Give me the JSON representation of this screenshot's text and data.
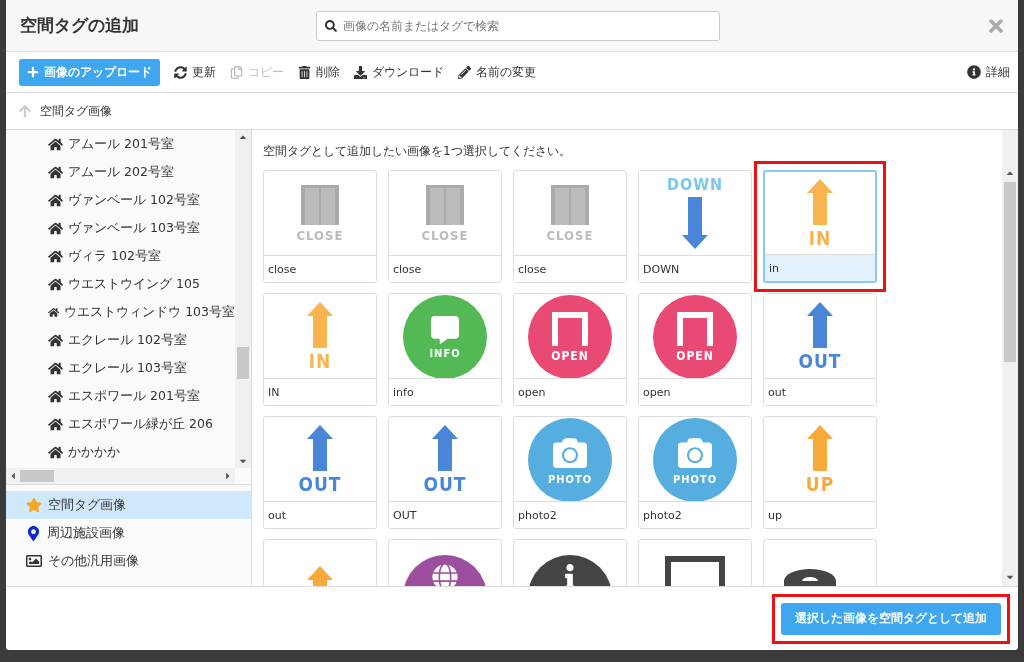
{
  "dialog": {
    "title": "空間タグの追加",
    "search": {
      "placeholder": "画像の名前またはタグで検索"
    }
  },
  "toolbar": {
    "upload": "画像のアップロード",
    "actions": [
      {
        "label": "更新",
        "disabled": false
      },
      {
        "label": "コピー",
        "disabled": true
      },
      {
        "label": "削除",
        "disabled": false
      },
      {
        "label": "ダウンロード",
        "disabled": false
      },
      {
        "label": "名前の変更",
        "disabled": false
      }
    ],
    "details": "詳細"
  },
  "breadcrumb": "空間タグ画像",
  "tree": [
    "アムール 201号室",
    "アムール 202号室",
    "ヴァンベール 102号室",
    "ヴァンベール 103号室",
    "ヴィラ 102号室",
    "ウエストウイング 105",
    "ウエストウィンドウ 103号室",
    "エクレール 102号室",
    "エクレール 103号室",
    "エスポワール 201号室",
    "エスポワール緑が丘 206",
    "かかかか"
  ],
  "categories": [
    {
      "label": "空間タグ画像",
      "selected": true
    },
    {
      "label": "周辺施設画像",
      "selected": false
    },
    {
      "label": "その他汎用画像",
      "selected": false
    }
  ],
  "instruction": "空間タグとして追加したい画像を1つ選択してください。",
  "tiles": [
    {
      "kind": "door",
      "text": "CLOSE",
      "label": "close",
      "selected": false,
      "highlighted": false
    },
    {
      "kind": "door",
      "text": "CLOSE",
      "label": "close",
      "selected": false,
      "highlighted": false
    },
    {
      "kind": "door",
      "text": "CLOSE",
      "label": "close",
      "selected": false,
      "highlighted": false
    },
    {
      "kind": "arrow-down",
      "text": "DOWN",
      "label": "DOWN",
      "color": "#4a86d8",
      "selected": false,
      "highlighted": false
    },
    {
      "kind": "arrow-up",
      "text": "IN",
      "label": "in",
      "color": "#f7b44f",
      "selected": true,
      "highlighted": true
    },
    {
      "kind": "arrow-up",
      "text": "IN",
      "label": "IN",
      "color": "#f7b44f",
      "selected": false,
      "highlighted": false
    },
    {
      "kind": "info",
      "text": "INFO",
      "label": "info",
      "color": "#52b955",
      "selected": false,
      "highlighted": false
    },
    {
      "kind": "door-badge",
      "text": "OPEN",
      "label": "open",
      "color": "#e94a74",
      "selected": false,
      "highlighted": false
    },
    {
      "kind": "door-badge",
      "text": "OPEN",
      "label": "open",
      "color": "#e94a74",
      "selected": false,
      "highlighted": false
    },
    {
      "kind": "arrow-up",
      "text": "OUT",
      "label": "out",
      "color": "#4a86d8",
      "selected": false,
      "highlighted": false
    },
    {
      "kind": "arrow-up",
      "text": "OUT",
      "label": "out",
      "color": "#4a86d8",
      "selected": false,
      "highlighted": false
    },
    {
      "kind": "arrow-up",
      "text": "OUT",
      "label": "OUT",
      "color": "#4a86d8",
      "selected": false,
      "highlighted": false
    },
    {
      "kind": "camera",
      "text": "PHOTO",
      "label": "photo2",
      "color": "#56aee0",
      "selected": false,
      "highlighted": false
    },
    {
      "kind": "camera",
      "text": "PHOTO",
      "label": "photo2",
      "color": "#56aee0",
      "selected": false,
      "highlighted": false
    },
    {
      "kind": "arrow-up",
      "text": "UP",
      "label": "up",
      "color": "#f7a93a",
      "selected": false,
      "highlighted": false
    },
    {
      "kind": "arrow-up",
      "color": "#f7a93a",
      "selected": false,
      "highlighted": false
    },
    {
      "kind": "globe",
      "color": "#9b4f9e",
      "selected": false,
      "highlighted": false
    },
    {
      "kind": "info-dark",
      "color": "#444444",
      "selected": false,
      "highlighted": false
    },
    {
      "kind": "outlet",
      "color": "#444444",
      "selected": false,
      "highlighted": false
    },
    {
      "kind": "tape",
      "color": "#444444",
      "selected": false,
      "highlighted": false
    }
  ],
  "submit": {
    "label": "選択した画像を空間タグとして追加",
    "highlighted": true
  }
}
